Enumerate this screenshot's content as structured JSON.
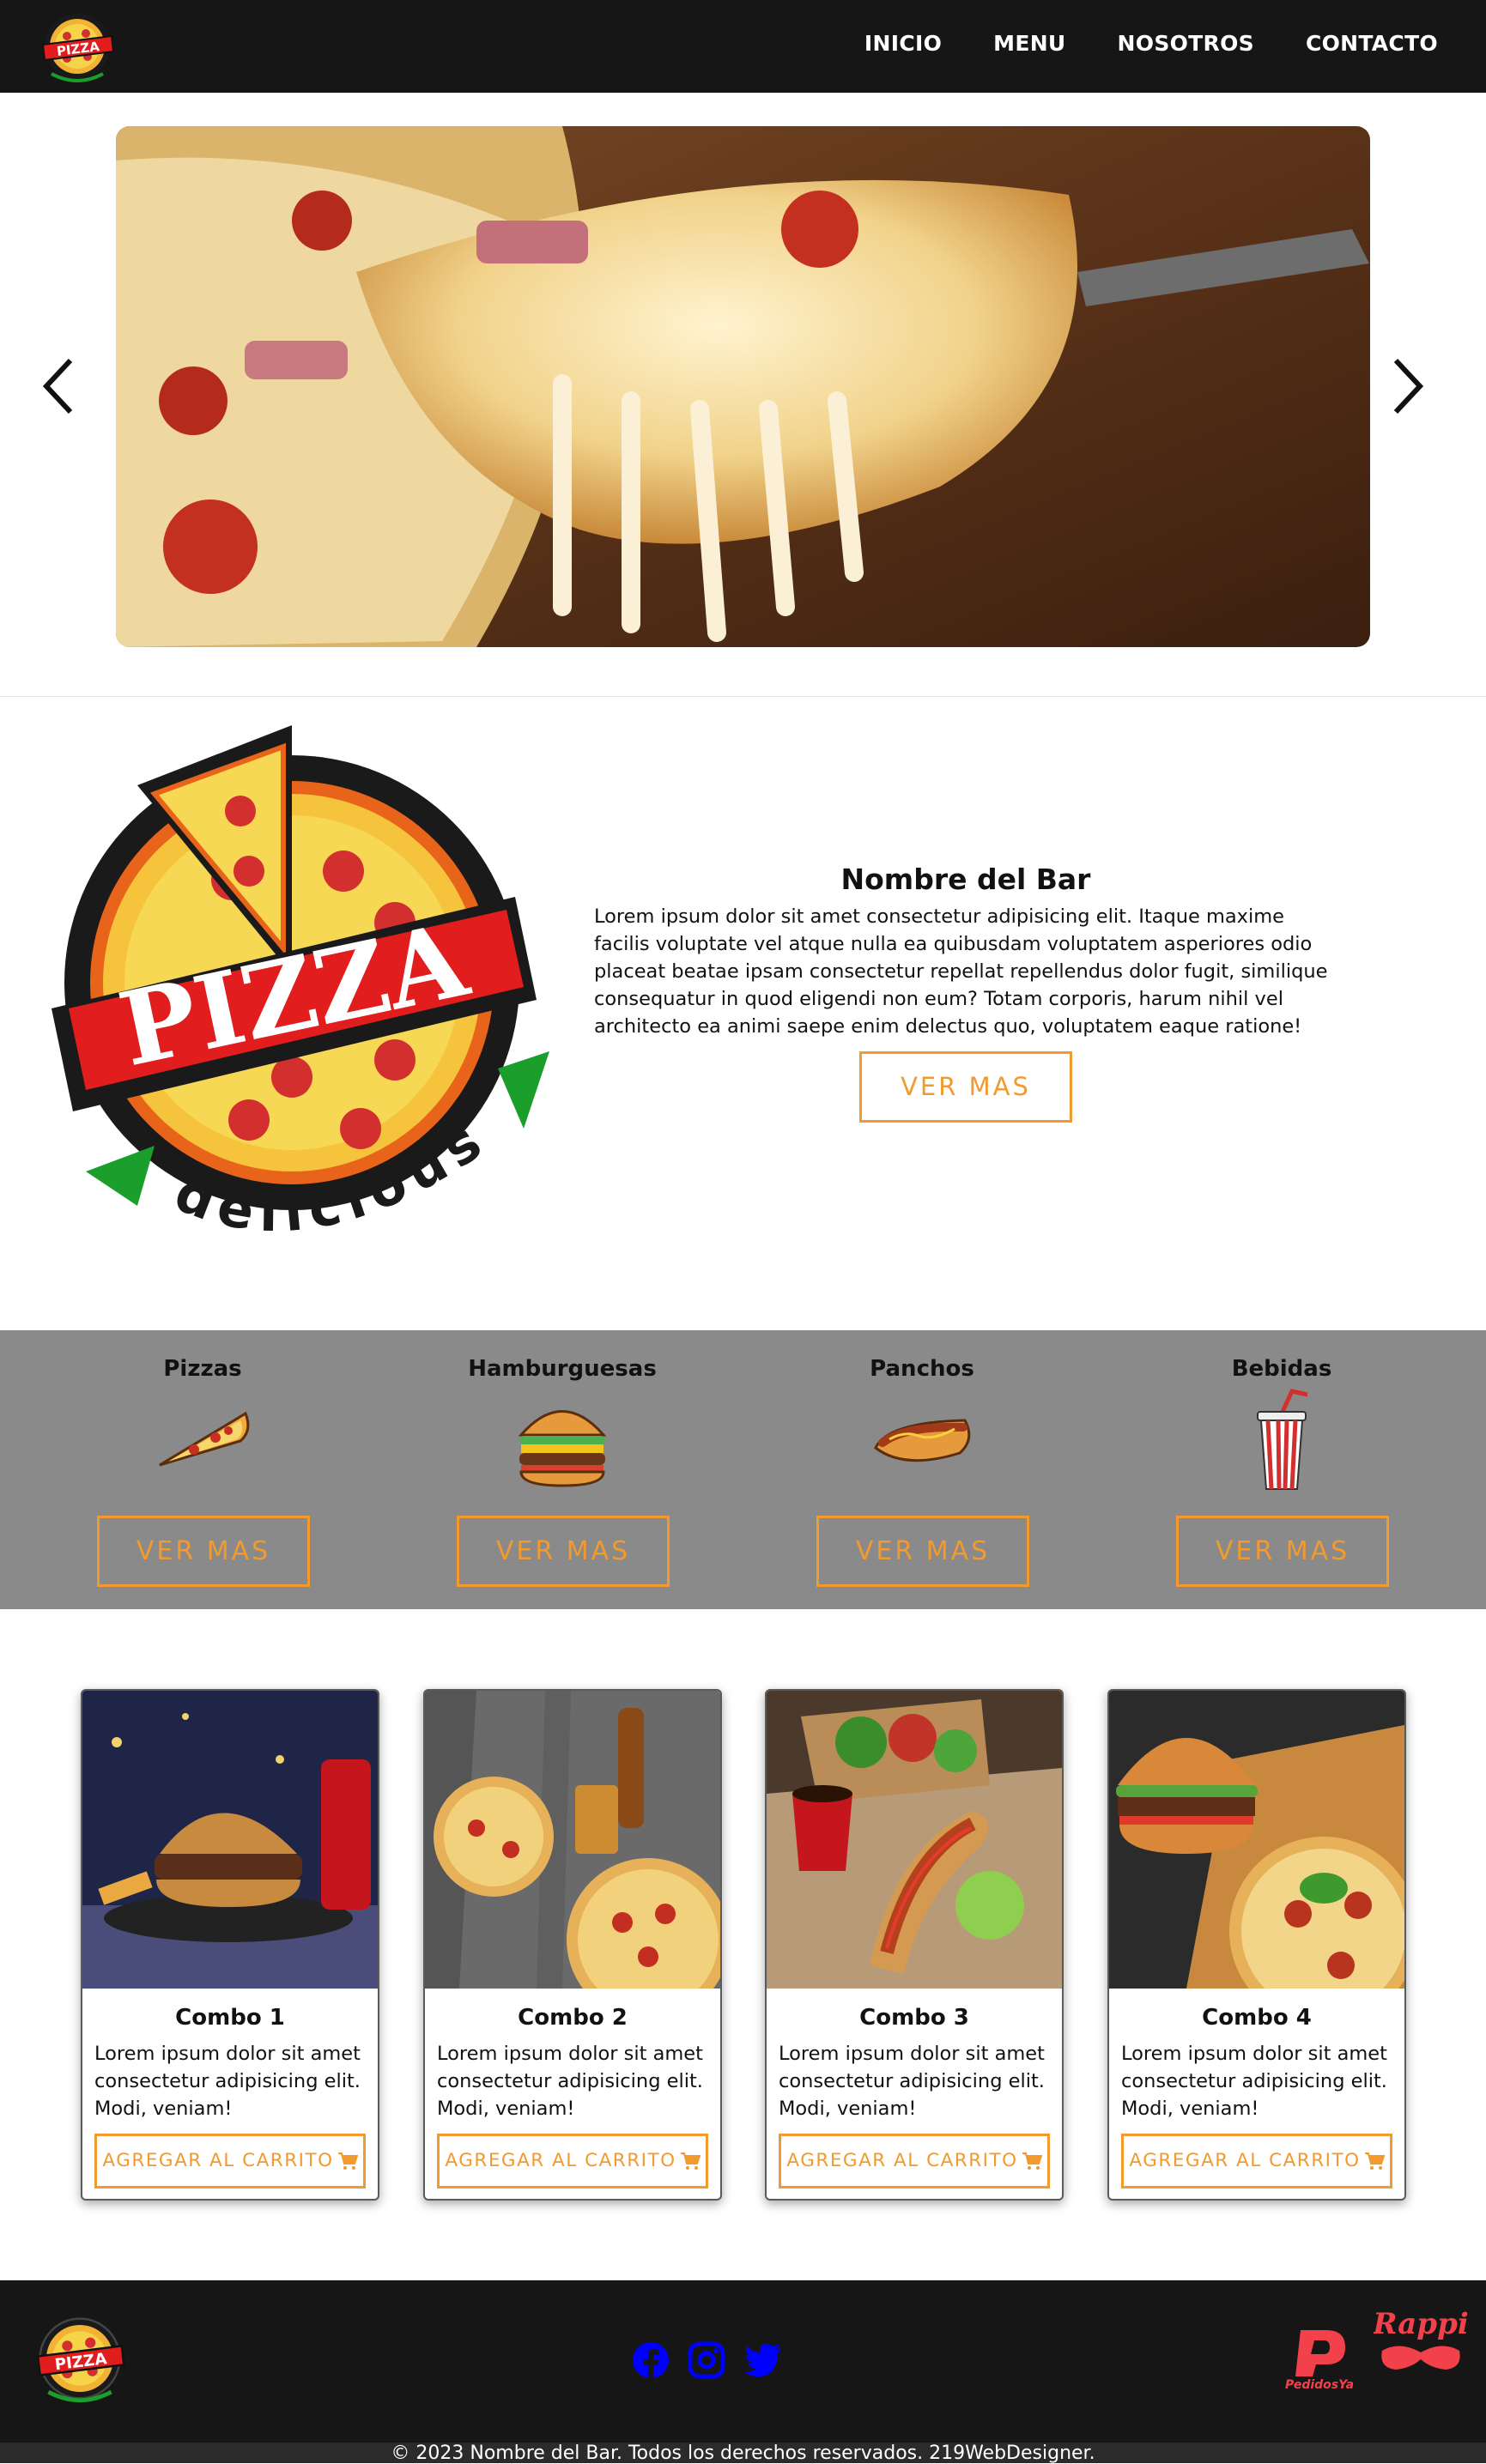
{
  "nav": {
    "logo_text": "PIZZA",
    "links": [
      "INICIO",
      "MENU",
      "NOSOTROS",
      "CONTACTO"
    ]
  },
  "about": {
    "logo_text": "PIZZA",
    "logo_tagline": "delicious",
    "title": "Nombre del Bar",
    "text": "Lorem ipsum dolor sit amet consectetur adipisicing elit. Itaque maxime facilis voluptate vel atque nulla ea quibusdam voluptatem asperiores odio placeat beatae ipsam consectetur repellat repellendus dolor fugit, similique consequatur in quod eligendi non eum? Totam corporis, harum nihil vel architecto ea animi saepe enim delectus quo, voluptatem eaque ratione!",
    "button": "VER MAS"
  },
  "categories": [
    {
      "title": "Pizzas",
      "icon": "pizza-slice-icon",
      "button": "VER MAS"
    },
    {
      "title": "Hamburguesas",
      "icon": "burger-icon",
      "button": "VER MAS"
    },
    {
      "title": "Panchos",
      "icon": "hotdog-icon",
      "button": "VER MAS"
    },
    {
      "title": "Bebidas",
      "icon": "soda-cup-icon",
      "button": "VER MAS"
    }
  ],
  "combos": [
    {
      "title": "Combo 1",
      "text": "Lorem ipsum dolor sit amet consectetur adipisicing elit. Modi, veniam!",
      "button": "AGREGAR AL CARRITO"
    },
    {
      "title": "Combo 2",
      "text": "Lorem ipsum dolor sit amet consectetur adipisicing elit. Modi, veniam!",
      "button": "AGREGAR AL CARRITO"
    },
    {
      "title": "Combo 3",
      "text": "Lorem ipsum dolor sit amet consectetur adipisicing elit. Modi, veniam!",
      "button": "AGREGAR AL CARRITO"
    },
    {
      "title": "Combo 4",
      "text": "Lorem ipsum dolor sit amet consectetur adipisicing elit. Modi, veniam!",
      "button": "AGREGAR AL CARRITO"
    }
  ],
  "footer": {
    "social": [
      "facebook-icon",
      "instagram-icon",
      "twitter-icon"
    ],
    "pedidosya_label": "PedidosYa",
    "rappi_label": "Rappi",
    "copyright": "© 2023 Nombre del Bar. Todos los derechos reservados. 219WebDesigner."
  },
  "colors": {
    "accent": "#f29a2e",
    "nav_bg": "#161616",
    "category_bg": "#8a8a8a",
    "social_blue": "#0000ff",
    "delivery_red": "#f2414b"
  }
}
